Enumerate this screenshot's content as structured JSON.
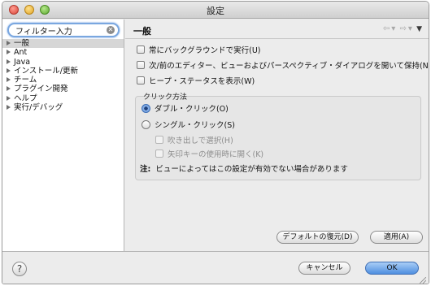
{
  "window": {
    "title": "設定"
  },
  "filter": {
    "value": "フィルター入力",
    "clear_icon": "clear-icon"
  },
  "tree": {
    "items": [
      {
        "label": "一般",
        "selected": true,
        "expandable": true
      },
      {
        "label": "Ant",
        "expandable": true
      },
      {
        "label": "Java",
        "expandable": true
      },
      {
        "label": "インストール/更新",
        "expandable": true
      },
      {
        "label": "チーム",
        "expandable": true
      },
      {
        "label": "プラグイン開発",
        "expandable": true
      },
      {
        "label": "ヘルプ",
        "expandable": true
      },
      {
        "label": "実行/デバッグ",
        "expandable": true
      }
    ]
  },
  "page": {
    "title": "一般",
    "nav": {
      "back": "⇦",
      "forward": "⇨",
      "menu": "▼"
    },
    "options": [
      {
        "label": "常にバックグラウンドで実行(U)",
        "checked": false
      },
      {
        "label": "次/前のエディター、ビューおよびパースペクティブ・ダイアログを開いて保持(N)",
        "checked": false
      },
      {
        "label": "ヒープ・ステータスを表示(W)",
        "checked": false
      }
    ],
    "click_group": {
      "title": "クリック方法",
      "double": "ダブル・クリック(O)",
      "single": "シングル・クリック(S)",
      "hover": "吹き出しで選択(H)",
      "arrow": "矢印キーの使用時に開く(K)",
      "note_label": "注:",
      "note": "ビューによってはこの設定が有効でない場合があります",
      "selected": "double"
    },
    "restore_defaults": "デフォルトの復元(D)",
    "apply": "適用(A)"
  },
  "footer": {
    "help": "?",
    "cancel": "キャンセル",
    "ok": "OK"
  },
  "colors": {
    "accent": "#4e8fe0",
    "selection": "#d6d6d6"
  }
}
